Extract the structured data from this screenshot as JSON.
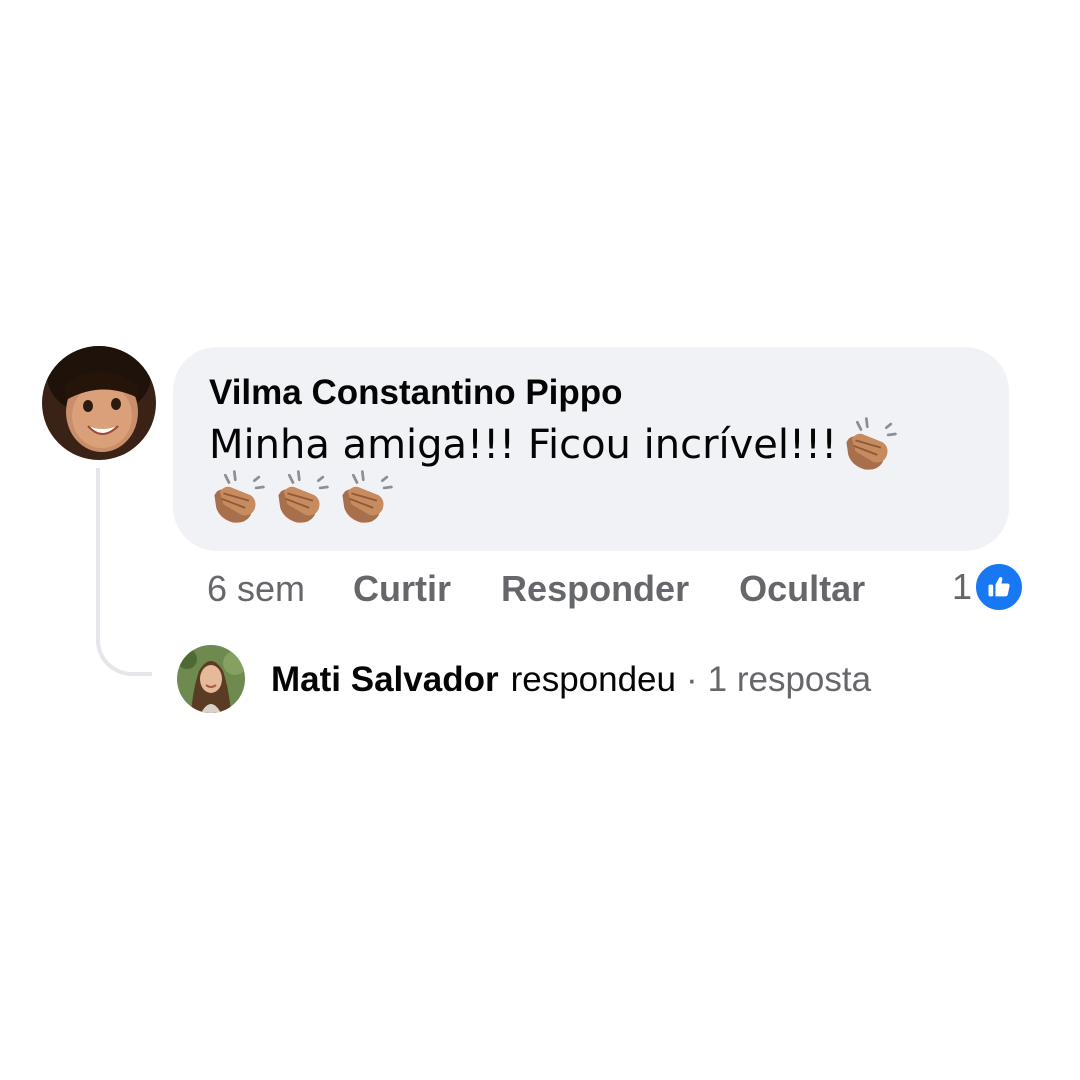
{
  "comment": {
    "author": "Vilma Constantino Pippo",
    "text": "Minha amiga!!! Ficou incrível!!!",
    "emoji": "clapping-hands-medium-skin-tone"
  },
  "actions": {
    "time": "6 sem",
    "like": "Curtir",
    "reply": "Responder",
    "hide": "Ocultar"
  },
  "reactions": {
    "count": "1",
    "type": "like-icon",
    "color": "#1877f2"
  },
  "replies": {
    "author": "Mati Salvador",
    "verb": "respondeu",
    "separator": "·",
    "count_label": "1 resposta"
  },
  "colors": {
    "bubble": "#f0f2f5",
    "secondary_text": "#65676b",
    "primary_text": "#050505"
  }
}
